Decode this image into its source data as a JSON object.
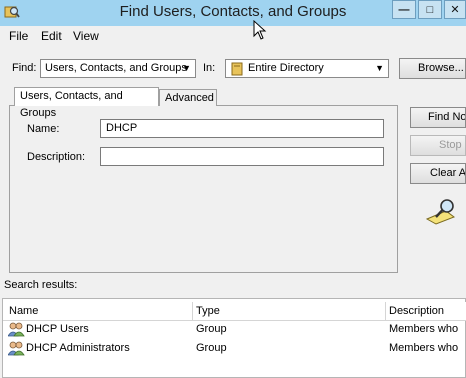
{
  "window": {
    "title": "Find Users, Contacts, and Groups",
    "buttons": [
      "—",
      "□",
      "✕"
    ]
  },
  "menu": [
    "File",
    "Edit",
    "View"
  ],
  "find_row": {
    "find_label": "Find:",
    "find_value": "Users, Contacts, and Groups",
    "in_label": "In:",
    "in_value": "Entire Directory",
    "browse_label": "Browse..."
  },
  "tabs": [
    "Users, Contacts, and Groups",
    "Advanced"
  ],
  "form": {
    "name_label": "Name:",
    "name_value": "DHCP",
    "description_label": "Description:",
    "description_value": ""
  },
  "side_buttons": {
    "find_now": "Find Now",
    "stop": "Stop",
    "clear_all": "Clear All"
  },
  "results": {
    "label": "Search results:",
    "columns": [
      "Name",
      "Type",
      "Description"
    ],
    "rows": [
      {
        "name": "DHCP Users",
        "type": "Group",
        "description": "Members who"
      },
      {
        "name": "DHCP Administrators",
        "type": "Group",
        "description": "Members who"
      }
    ]
  }
}
